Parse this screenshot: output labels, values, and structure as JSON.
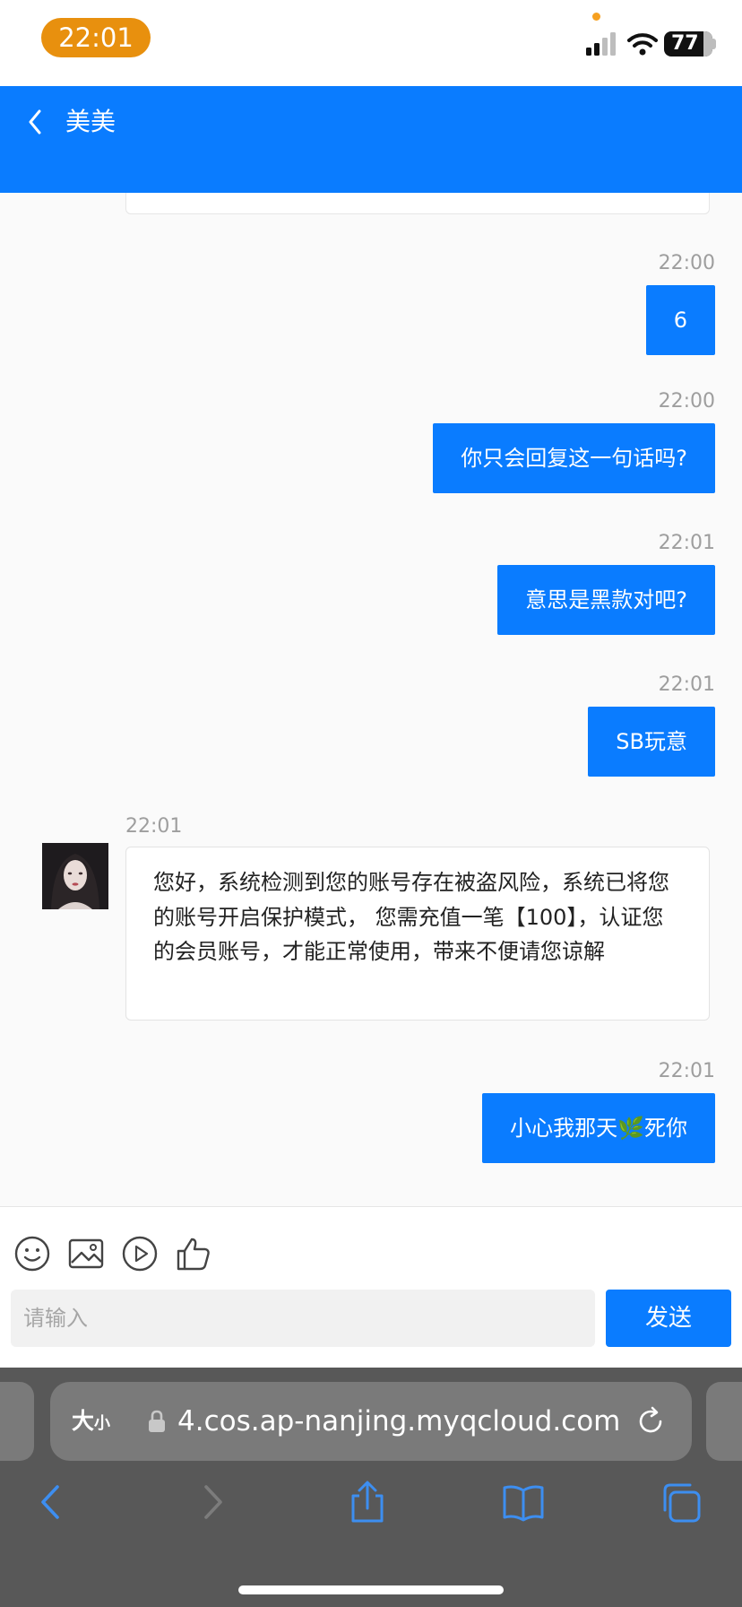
{
  "status_bar": {
    "time": "22:01",
    "battery": "77"
  },
  "header": {
    "contact_name": "美美"
  },
  "messages": [
    {
      "time": "22:00",
      "text": "6"
    },
    {
      "time": "22:00",
      "text": "你只会回复这一句话吗?"
    },
    {
      "time": "22:01",
      "text": "意思是黑款对吧?"
    },
    {
      "time": "22:01",
      "text": "SB玩意"
    },
    {
      "time": "22:01",
      "text": "您好，系统检测到您的账号存在被盗风险，系统已将您的账号开启保护模式， 您需充值一笔【100】，认证您的会员账号，才能正常使用，带来不便请您谅解"
    },
    {
      "time": "22:01",
      "text": "小心我那天🌿死你"
    }
  ],
  "composer": {
    "placeholder": "请输入",
    "send_label": "发送"
  },
  "browser": {
    "text_size_big": "大",
    "text_size_small": "小",
    "url": "4.cos.ap-nanjing.myqcloud.com"
  },
  "colors": {
    "accent": "#0a7cff",
    "time_pill": "#e8900e",
    "safari_bar": "#585858"
  }
}
